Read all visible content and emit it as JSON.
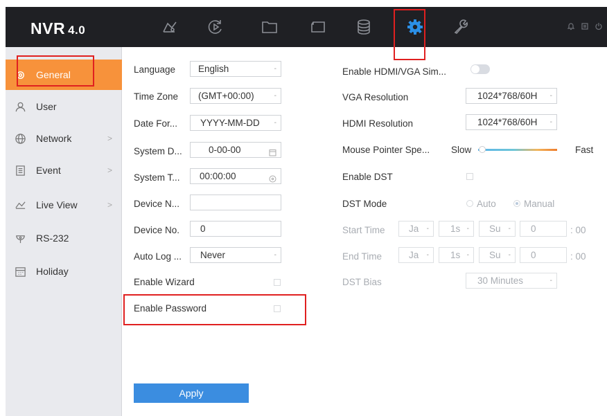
{
  "app": {
    "logo_main": "NVR",
    "logo_version": "4.0"
  },
  "topnav": {
    "icons": [
      "live-view-icon",
      "playback-icon",
      "file-management-icon",
      "device-icon",
      "storage-icon",
      "settings-gear-icon",
      "maintenance-wrench-icon"
    ],
    "active": "settings-gear-icon",
    "right_icons": [
      "notification-icon",
      "account-icon",
      "power-icon"
    ]
  },
  "sidebar": {
    "items": [
      {
        "label": "General",
        "icon": "gear-icon",
        "active": true,
        "has_chevron": false
      },
      {
        "label": "User",
        "icon": "user-icon",
        "active": false,
        "has_chevron": false
      },
      {
        "label": "Network",
        "icon": "globe-icon",
        "active": false,
        "has_chevron": true
      },
      {
        "label": "Event",
        "icon": "document-icon",
        "active": false,
        "has_chevron": true
      },
      {
        "label": "Live View",
        "icon": "live-view-icon",
        "active": false,
        "has_chevron": true
      },
      {
        "label": "RS-232",
        "icon": "serial-port-icon",
        "active": false,
        "has_chevron": false
      },
      {
        "label": "Holiday",
        "icon": "calendar-icon",
        "active": false,
        "has_chevron": false
      }
    ]
  },
  "form_left": {
    "language": {
      "label": "Language",
      "value": "English"
    },
    "time_zone": {
      "label": "Time Zone",
      "value": "(GMT+00:00) "
    },
    "date_format": {
      "label": "Date For...",
      "value": "YYYY-MM-DD"
    },
    "system_date": {
      "label": "System D...",
      "value": "0-00-00"
    },
    "system_time": {
      "label": "System T...",
      "value": "00:00:00"
    },
    "device_name": {
      "label": "Device N...",
      "value": ""
    },
    "device_no": {
      "label": "Device No.",
      "value": "0"
    },
    "auto_logout": {
      "label": "Auto Log ...",
      "value": "Never"
    },
    "enable_wizard": {
      "label": "Enable Wizard",
      "checked": false
    },
    "enable_password": {
      "label": "Enable Password",
      "checked": false
    }
  },
  "form_right": {
    "enable_hdmi_vga": {
      "label": "Enable HDMI/VGA Sim...",
      "on": false
    },
    "vga_resolution": {
      "label": "VGA Resolution",
      "value": "1024*768/60H"
    },
    "hdmi_resolution": {
      "label": "HDMI Resolution",
      "value": "1024*768/60H"
    },
    "mouse_speed": {
      "label": "Mouse Pointer Spe...",
      "min_label": "Slow",
      "max_label": "Fast",
      "level": 0.05
    },
    "enable_dst": {
      "label": "Enable DST",
      "checked": false
    },
    "dst_mode": {
      "label": "DST Mode",
      "option_auto": "Auto",
      "option_manual": "Manual",
      "selected": "Manual"
    },
    "start_time": {
      "label": "Start Time",
      "month": "Ja",
      "week": "1s",
      "day": "Su",
      "hour": "0",
      "minute": ": 00"
    },
    "end_time": {
      "label": "End Time",
      "month": "Ja",
      "week": "1s",
      "day": "Su",
      "hour": "0",
      "minute": ": 00"
    },
    "dst_bias": {
      "label": "DST Bias",
      "value": "30 Minutes"
    }
  },
  "actions": {
    "apply_label": "Apply"
  },
  "colors": {
    "topbar": "#1f2024",
    "active_orange": "#f7923b",
    "gear_blue": "#2b8fe6",
    "apply_blue": "#3b8de0",
    "highlight_red": "#e02020"
  }
}
